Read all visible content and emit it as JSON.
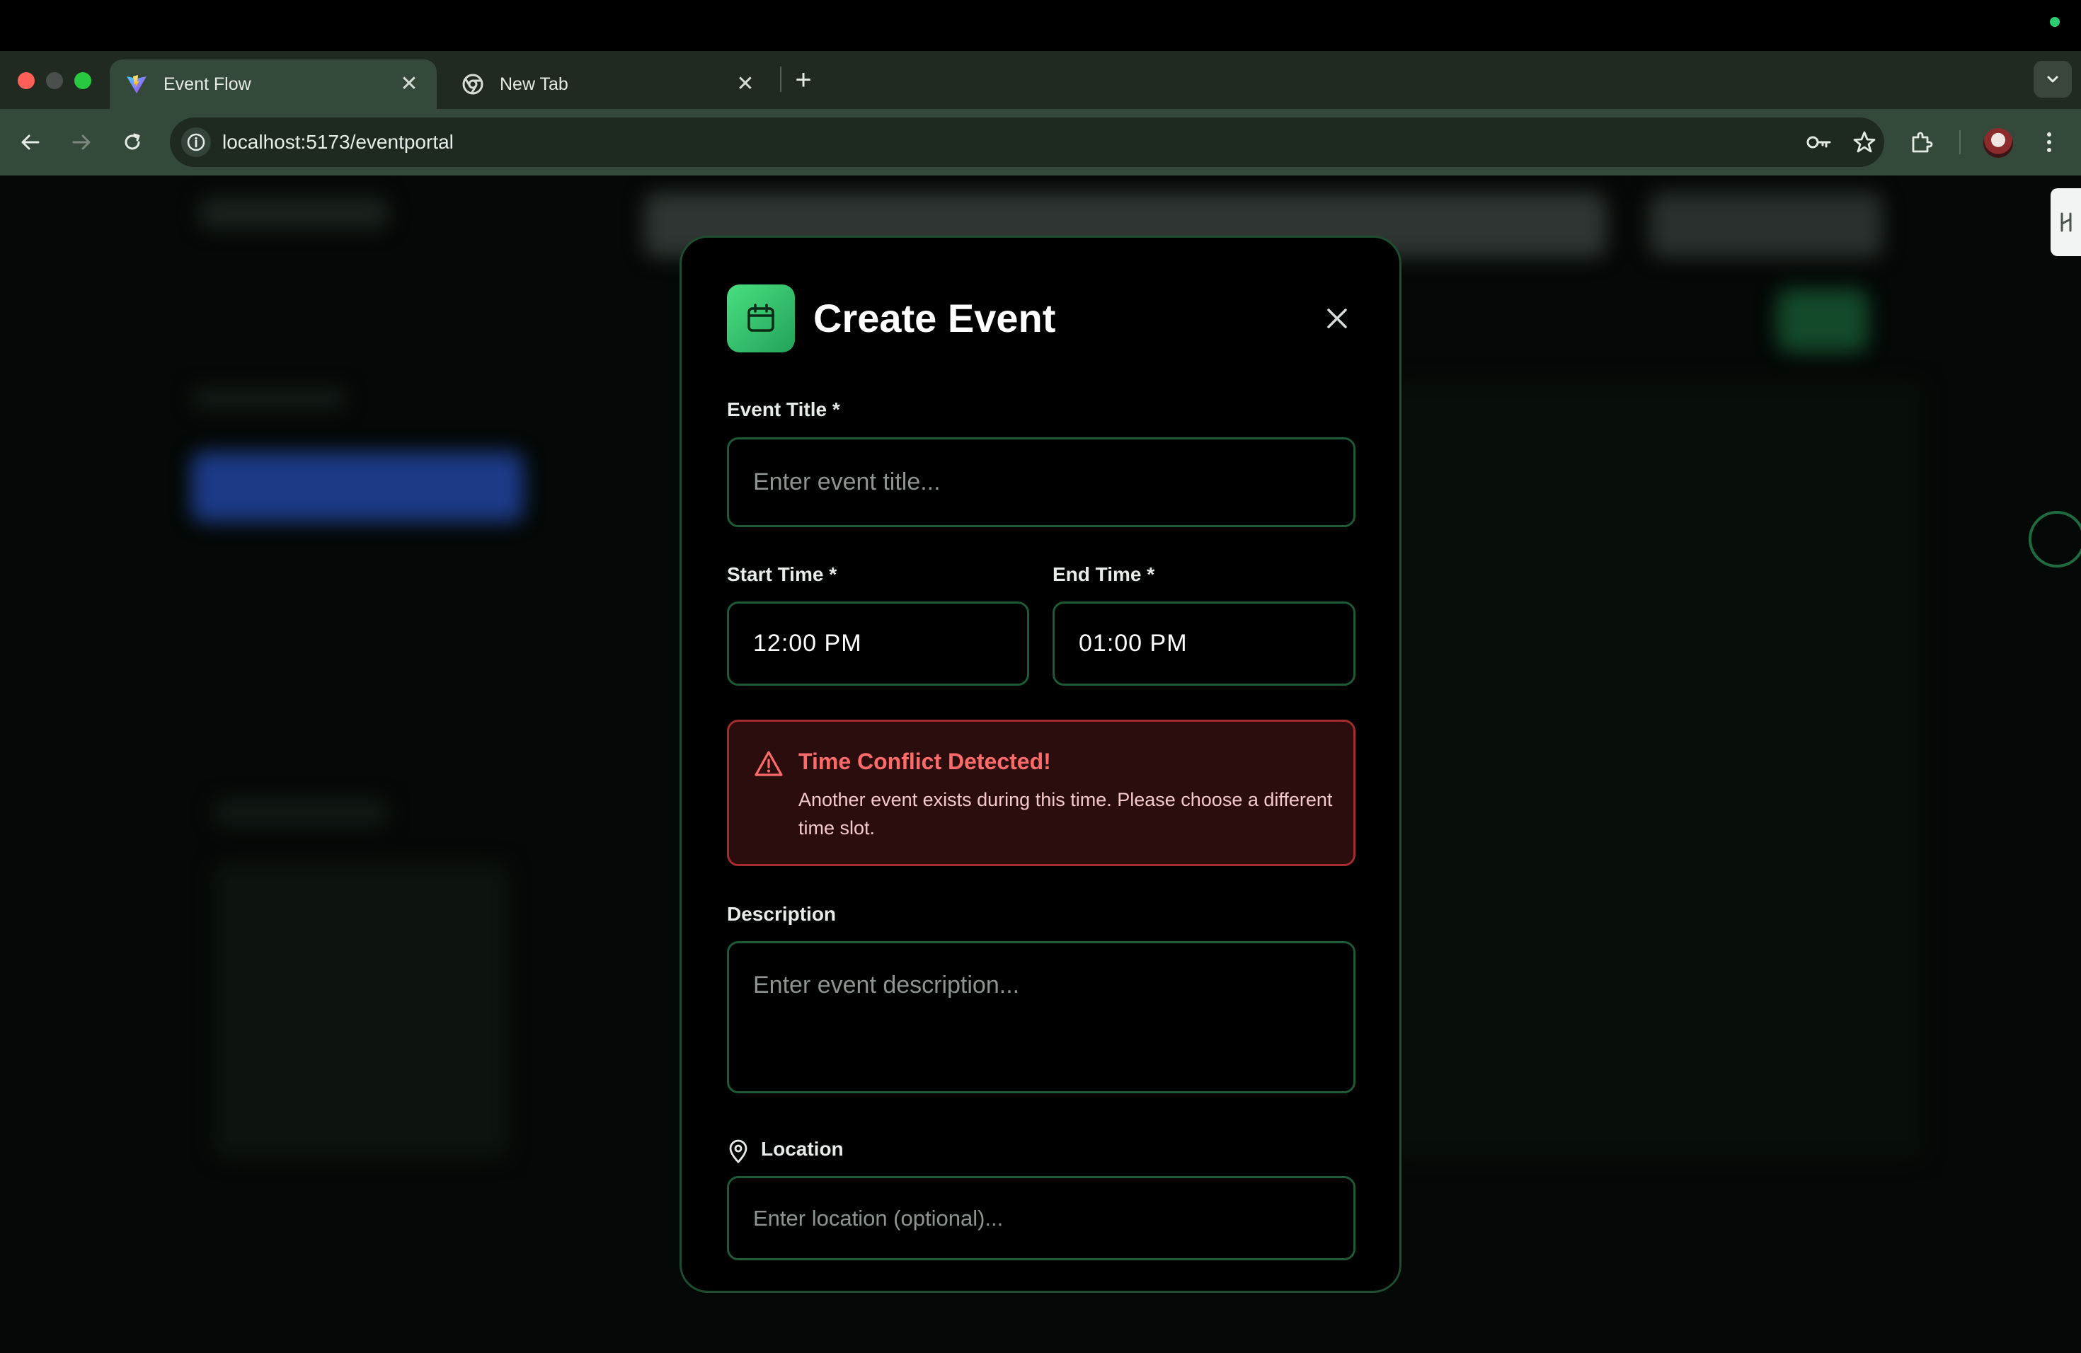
{
  "browser": {
    "tabs": [
      {
        "title": "Event Flow",
        "active": true,
        "icon": "vite-logo-icon"
      },
      {
        "title": "New Tab",
        "active": false,
        "icon": "chrome-icon"
      }
    ],
    "close_glyph": "✕",
    "new_tab_glyph": "+",
    "url": "localhost:5173/eventportal"
  },
  "modal": {
    "title": "Create Event",
    "icon": "calendar-icon",
    "fields": {
      "event_title": {
        "label": "Event Title *",
        "placeholder": "Enter event title..."
      },
      "start_time": {
        "label": "Start Time *",
        "value": "12:00 PM"
      },
      "end_time": {
        "label": "End Time *",
        "value": "01:00 PM"
      },
      "description": {
        "label": "Description",
        "placeholder": "Enter event description..."
      },
      "location": {
        "label": "Location",
        "placeholder": "Enter location (optional)..."
      }
    },
    "alert": {
      "title": "Time Conflict Detected!",
      "message": "Another event exists during this time. Please choose a different time slot."
    }
  },
  "colors": {
    "accent_green": "#22c55e",
    "field_border": "#1e5a35",
    "alert_red": "#ff6b6b",
    "alert_bg": "#2b0d0d"
  }
}
